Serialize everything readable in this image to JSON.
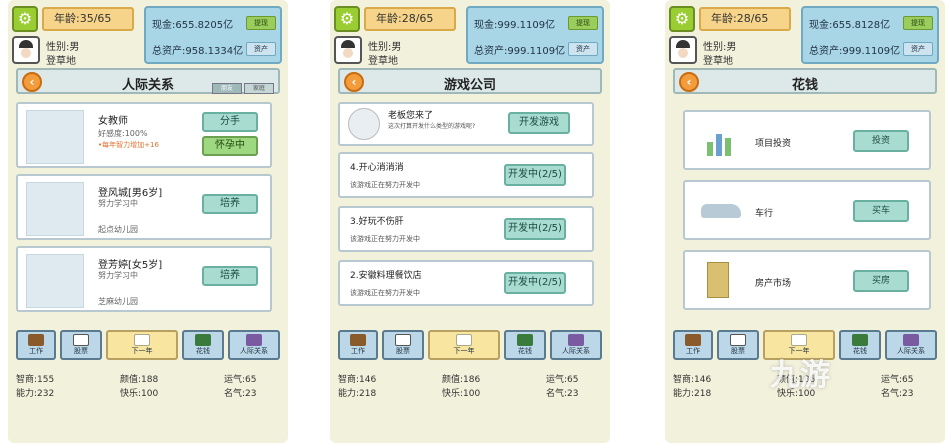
{
  "panels": [
    {
      "age": "年龄:35/65",
      "gender": "性别:男",
      "place": "登草地",
      "cash": "现金:655.8205亿",
      "cash_btn": "提现",
      "assets": "总资产:958.1334亿",
      "assets_btn": "资产",
      "title": "人际关系",
      "tab1": "朋友",
      "tab2": "家庭",
      "toolbar": [
        "工作",
        "股票",
        "下一年",
        "花钱",
        "人际关系"
      ],
      "stats": {
        "iq": "智商:155",
        "ability": "能力:232",
        "face": "颜值:188",
        "happy": "快乐:100",
        "luck": "运气:65",
        "fame": "名气:23"
      }
    },
    {
      "age": "年龄:28/65",
      "gender": "性别:男",
      "place": "登草地",
      "cash": "现金:999.1109亿",
      "cash_btn": "提现",
      "assets": "总资产:999.1109亿",
      "assets_btn": "资产",
      "title": "游戏公司",
      "toolbar": [
        "工作",
        "股票",
        "下一年",
        "花钱",
        "人际关系"
      ],
      "stats": {
        "iq": "智商:146",
        "ability": "能力:218",
        "face": "颜值:186",
        "happy": "快乐:100",
        "luck": "运气:65",
        "fame": "名气:23"
      }
    },
    {
      "age": "年龄:28/65",
      "gender": "性别:男",
      "place": "登草地",
      "cash": "现金:655.8128亿",
      "cash_btn": "提现",
      "assets": "总资产:999.1109亿",
      "assets_btn": "资产",
      "title": "花钱",
      "toolbar": [
        "工作",
        "股票",
        "下一年",
        "花钱",
        "人际关系"
      ],
      "stats": {
        "iq": "智商:146",
        "ability": "能力:218",
        "face": "颜值:186",
        "happy": "快乐:100",
        "luck": "运气:65",
        "fame": "名气:23"
      }
    }
  ],
  "relations": [
    {
      "name": "女教师",
      "line1": "好感度:100%",
      "line2": "•每年智力增加+16",
      "btn1": "分手",
      "btn2": "怀孕中"
    },
    {
      "name": "登风城[男6岁]",
      "line1": "努力学习中",
      "line2": "起点幼儿园",
      "btn1": "培养"
    },
    {
      "name": "登芳婷[女5岁]",
      "line1": "努力学习中",
      "line2": "芝麻幼儿园",
      "btn1": "培养"
    }
  ],
  "company": {
    "boss_line1": "老板您来了",
    "boss_line2": "这次打算开发什么类型的游戏呢?",
    "boss_btn": "开发游戏",
    "games": [
      {
        "name": "4.开心消消消",
        "status": "该游戏正在努力开发中",
        "btn": "开发中(2/5)"
      },
      {
        "name": "3.好玩不伤肝",
        "status": "该游戏正在努力开发中",
        "btn": "开发中(2/5)"
      },
      {
        "name": "2.安徽料理餐饮店",
        "status": "该游戏正在努力开发中",
        "btn": "开发中(2/5)"
      }
    ]
  },
  "spend": [
    {
      "label": "项目投资",
      "btn": "投资"
    },
    {
      "label": "车行",
      "btn": "买车"
    },
    {
      "label": "房产市场",
      "btn": "买房"
    }
  ],
  "watermark": "九游"
}
